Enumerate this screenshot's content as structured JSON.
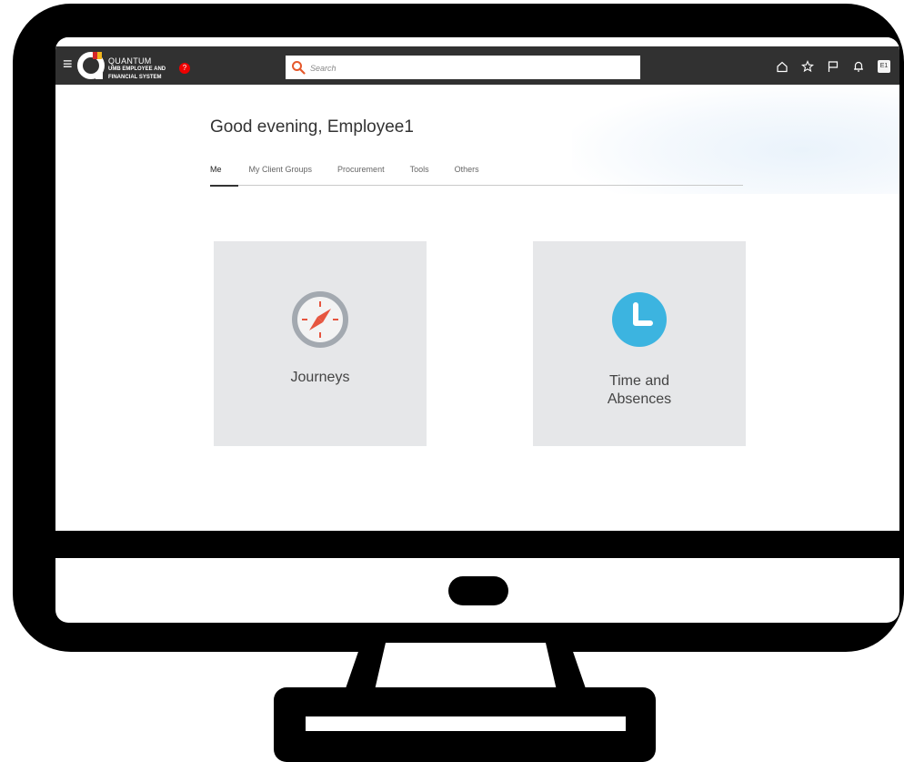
{
  "app": {
    "logo_name": "QUANTUM",
    "logo_line2": "UMB EMPLOYEE AND",
    "logo_line3": "FINANCIAL SYSTEM",
    "help_badge": "?"
  },
  "search": {
    "placeholder": "Search"
  },
  "header": {
    "avatar_initials": "E1"
  },
  "greeting": "Good evening, Employee1",
  "tabs": [
    {
      "label": "Me",
      "active": true
    },
    {
      "label": "My Client Groups",
      "active": false
    },
    {
      "label": "Procurement",
      "active": false
    },
    {
      "label": "Tools",
      "active": false
    },
    {
      "label": "Others",
      "active": false
    }
  ],
  "tiles": [
    {
      "label": "Journeys",
      "icon": "compass-icon"
    },
    {
      "label_line1": "Time and",
      "label_line2": "Absences",
      "icon": "clock-icon"
    }
  ],
  "colors": {
    "topbar": "#313131",
    "search_accent": "#e5582b",
    "compass_red": "#e6553f",
    "clock_blue": "#3cb4e0",
    "tile_bg": "#e6e7e9"
  }
}
